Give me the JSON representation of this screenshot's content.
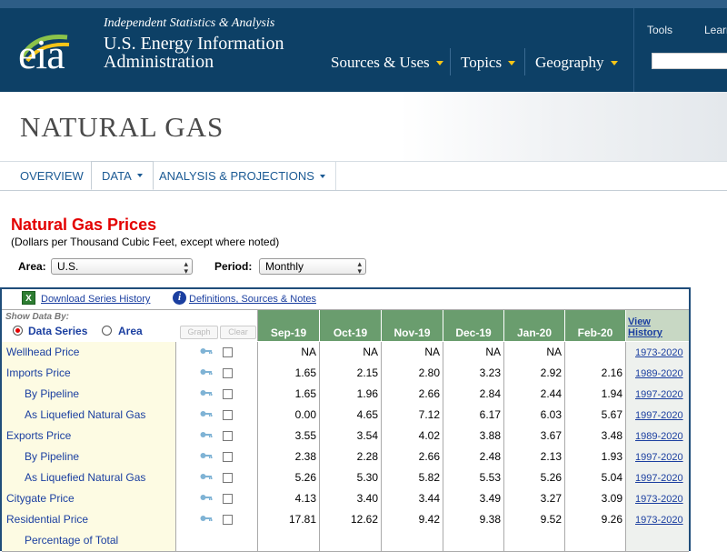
{
  "header": {
    "logo_text": "eia",
    "tagline": "Independent Statistics & Analysis",
    "org_line1": "U.S. Energy Information",
    "org_line2": "Administration",
    "nav": [
      "Sources & Uses",
      "Topics",
      "Geography"
    ],
    "tools_links": [
      "Tools",
      "Learn"
    ]
  },
  "section_title": "NATURAL GAS",
  "tabs": [
    "OVERVIEW",
    "DATA",
    "ANALYSIS & PROJECTIONS"
  ],
  "page": {
    "heading": "Natural Gas Prices",
    "subheading": "(Dollars per Thousand Cubic Feet, except where noted)",
    "area_label": "Area:",
    "area_value": "U.S.",
    "period_label": "Period:",
    "period_value": "Monthly"
  },
  "toolbar": {
    "download_label": "Download Series History",
    "definitions_label": "Definitions, Sources & Notes"
  },
  "table": {
    "show_by_label": "Show Data By:",
    "radio_series": "Data Series",
    "radio_area": "Area",
    "graph_btn": "Graph",
    "clear_btn": "Clear",
    "columns": [
      "Sep-19",
      "Oct-19",
      "Nov-19",
      "Dec-19",
      "Jan-20",
      "Feb-20"
    ],
    "history_header": "View History",
    "rows": [
      {
        "label": "Wellhead Price",
        "indent": false,
        "values": [
          "NA",
          "NA",
          "NA",
          "NA",
          "NA",
          ""
        ],
        "history": "1973-2020"
      },
      {
        "label": "Imports Price",
        "indent": false,
        "values": [
          "1.65",
          "2.15",
          "2.80",
          "3.23",
          "2.92",
          "2.16"
        ],
        "history": "1989-2020"
      },
      {
        "label": "By Pipeline",
        "indent": true,
        "values": [
          "1.65",
          "1.96",
          "2.66",
          "2.84",
          "2.44",
          "1.94"
        ],
        "history": "1997-2020"
      },
      {
        "label": "As Liquefied Natural Gas",
        "indent": true,
        "values": [
          "0.00",
          "4.65",
          "7.12",
          "6.17",
          "6.03",
          "5.67"
        ],
        "history": "1997-2020"
      },
      {
        "label": "Exports Price",
        "indent": false,
        "values": [
          "3.55",
          "3.54",
          "4.02",
          "3.88",
          "3.67",
          "3.48"
        ],
        "history": "1989-2020"
      },
      {
        "label": "By Pipeline",
        "indent": true,
        "values": [
          "2.38",
          "2.28",
          "2.66",
          "2.48",
          "2.13",
          "1.93"
        ],
        "history": "1997-2020"
      },
      {
        "label": "As Liquefied Natural Gas",
        "indent": true,
        "values": [
          "5.26",
          "5.30",
          "5.82",
          "5.53",
          "5.26",
          "5.04"
        ],
        "history": "1997-2020"
      },
      {
        "label": "Citygate Price",
        "indent": false,
        "values": [
          "4.13",
          "3.40",
          "3.44",
          "3.49",
          "3.27",
          "3.09"
        ],
        "history": "1973-2020"
      },
      {
        "label": "Residential Price",
        "indent": false,
        "values": [
          "17.81",
          "12.62",
          "9.42",
          "9.38",
          "9.52",
          "9.26"
        ],
        "history": "1973-2020"
      },
      {
        "label": "Percentage of Total",
        "indent": true,
        "values": [
          "",
          "",
          "",
          "",
          "",
          ""
        ],
        "history": ""
      }
    ]
  },
  "colors": {
    "header_bg": "#0d4066",
    "accent_red": "#e30000",
    "column_header_green": "#6a9d6e",
    "label_bg": "#fdfbe3",
    "link_blue": "#1b3fa0"
  }
}
